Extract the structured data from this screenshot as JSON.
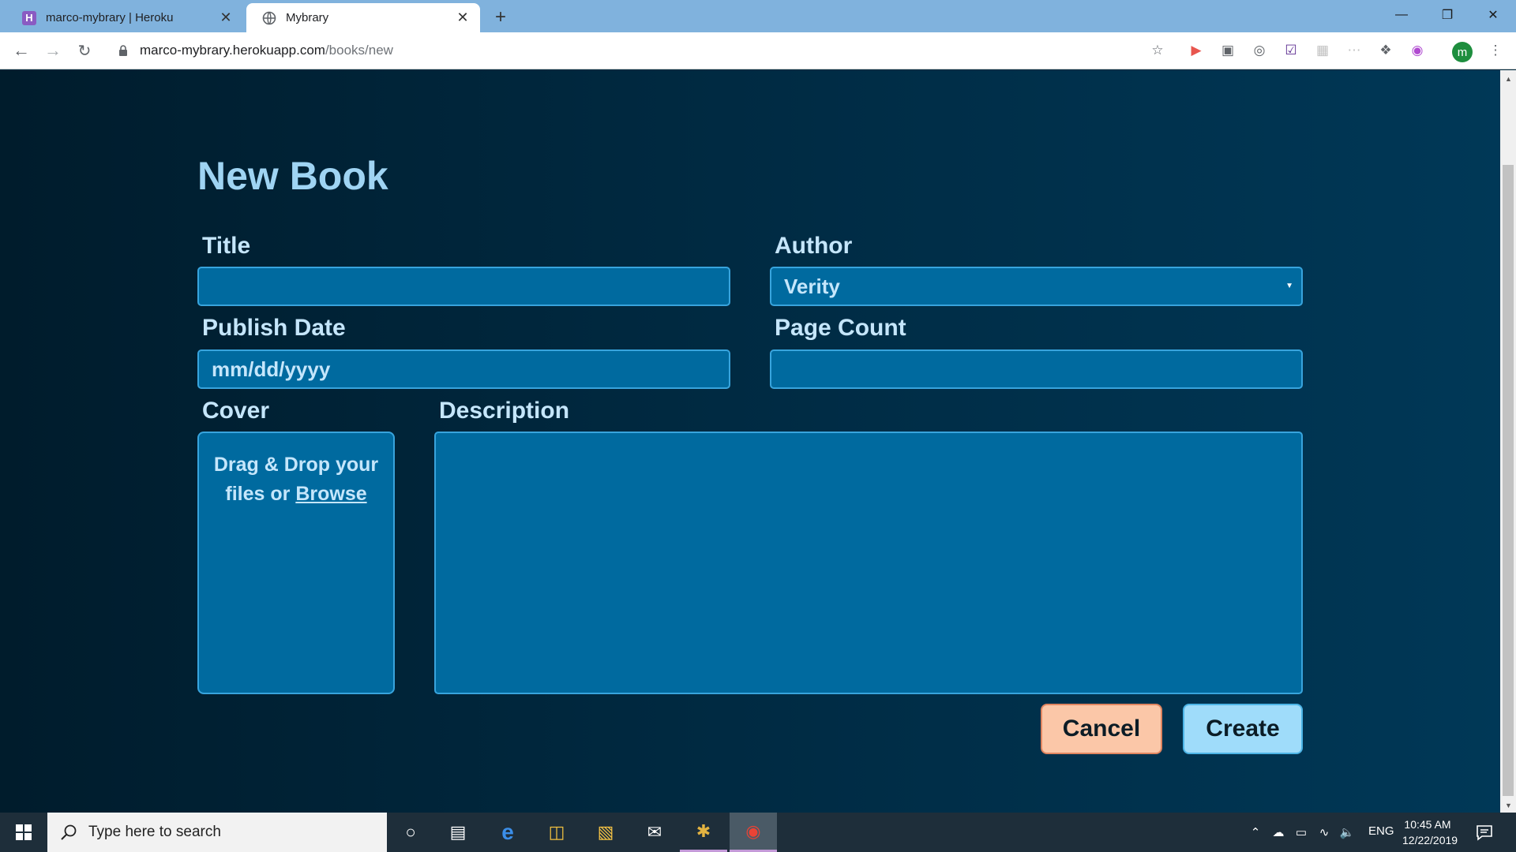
{
  "browser": {
    "tabs": [
      {
        "title": "marco-mybrary | Heroku",
        "favicon": "heroku-icon",
        "active": false
      },
      {
        "title": "Mybrary",
        "favicon": "globe-icon",
        "active": true
      }
    ],
    "url": {
      "host": "marco-mybrary.herokuapp.com",
      "path": "/books/new"
    },
    "profile_initial": "m"
  },
  "page": {
    "title": "New Book",
    "form": {
      "title_label": "Title",
      "title_value": "",
      "author_label": "Author",
      "author_selected": "Verity",
      "publish_date_label": "Publish Date",
      "publish_date_placeholder": "mm/dd/yyyy",
      "page_count_label": "Page Count",
      "page_count_value": "",
      "cover_label": "Cover",
      "cover_drop_text_line1": "Drag & Drop your",
      "cover_drop_text_line2": "files or",
      "cover_browse": "Browse",
      "description_label": "Description",
      "description_value": ""
    },
    "buttons": {
      "cancel": "Cancel",
      "create": "Create"
    }
  },
  "taskbar": {
    "search_placeholder": "Type here to search",
    "language": "ENG",
    "time": "10:45 AM",
    "date": "12/22/2019"
  },
  "colors": {
    "page_bg": "#002a40",
    "field_bg": "#006a9f",
    "title_color": "#9fd4f3",
    "cancel_bg": "#fbc7a8",
    "create_bg": "#9fdcfa"
  }
}
